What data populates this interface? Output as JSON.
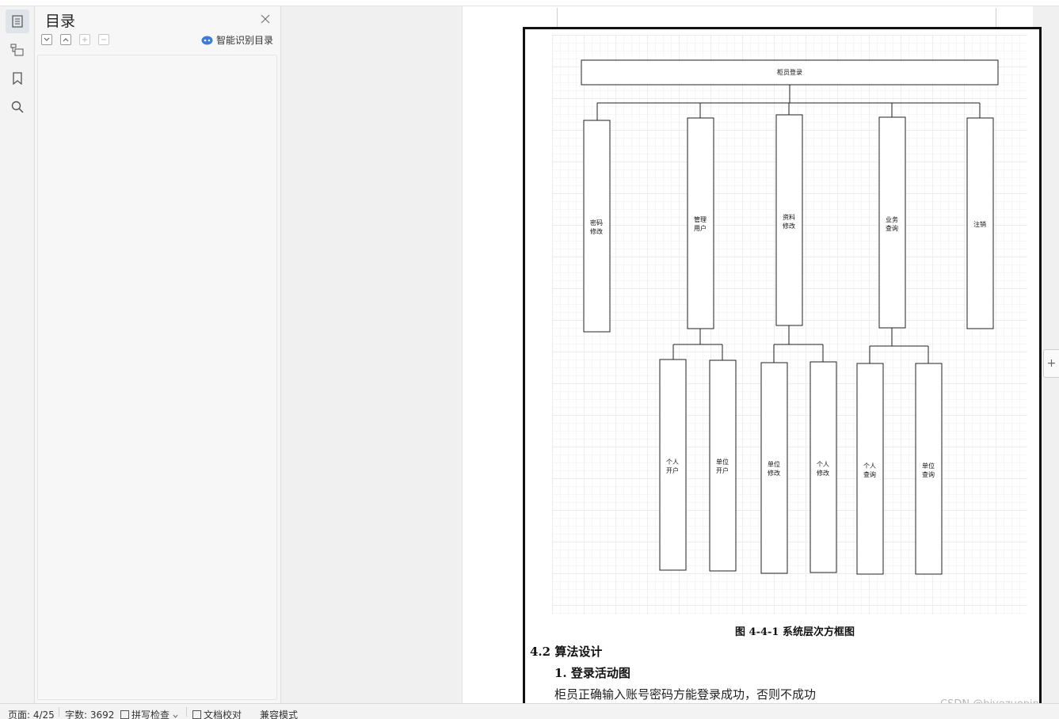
{
  "toc_panel": {
    "title": "目录",
    "smart_toc_label": "智能识别目录",
    "tools": [
      "expand-all-icon",
      "collapse-all-icon",
      "add-heading-icon",
      "remove-heading-icon"
    ]
  },
  "rail": {
    "icons": [
      "toc-icon",
      "nav-tree-icon",
      "bookmark-icon",
      "search-icon"
    ]
  },
  "diagram": {
    "root": "柜员登录",
    "level1": [
      {
        "label": [
          "密码",
          "修改"
        ],
        "children": []
      },
      {
        "label": [
          "管理",
          "用户"
        ],
        "children": [
          [
            "个人",
            "开户"
          ],
          [
            "单位",
            "开户"
          ]
        ]
      },
      {
        "label": [
          "资料",
          "修改"
        ],
        "children": [
          [
            "单位",
            "修改"
          ],
          [
            "个人",
            "修改"
          ]
        ]
      },
      {
        "label": [
          "业务",
          "查询"
        ],
        "children": [
          [
            "个人",
            "查询"
          ],
          [
            "单位",
            "查询"
          ]
        ]
      },
      {
        "label": [
          "注销"
        ],
        "children": []
      }
    ]
  },
  "document": {
    "figure_caption": "图 4-4-1  系统层次方框图",
    "section_heading": "4.2  算法设计",
    "subsection_heading": "1.  登录活动图",
    "paragraph": "柜员正确输入账号密码方能登录成功，否则不成功"
  },
  "status_bar": {
    "page": "页面: 4/25",
    "word_count": "字数: 3692",
    "spell_check": "拼写检查",
    "doc_proof": "文档校对",
    "compat_mode": "兼容模式"
  },
  "watermark": "CSDN @biyezuopin",
  "colors": {
    "accent": "#3b7cd8",
    "frame": "#111111",
    "grid": "#ececec"
  }
}
